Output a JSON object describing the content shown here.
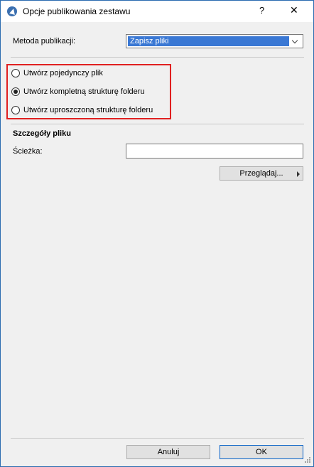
{
  "window": {
    "title": "Opcje publikowania zestawu",
    "help": "?",
    "close": "✕"
  },
  "method": {
    "label": "Metoda publikacji:",
    "selected": "Zapisz pliki"
  },
  "options": [
    {
      "label": "Utwórz pojedynczy plik",
      "checked": false
    },
    {
      "label": "Utwórz kompletną strukturę folderu",
      "checked": true
    },
    {
      "label": "Utwórz uproszczoną strukturę folderu",
      "checked": false
    }
  ],
  "details": {
    "heading": "Szczegóły pliku",
    "path_label": "Ścieżka:",
    "path_value": "",
    "browse_label": "Przeglądaj..."
  },
  "footer": {
    "cancel_label": "Anuluj",
    "ok_label": "OK"
  }
}
